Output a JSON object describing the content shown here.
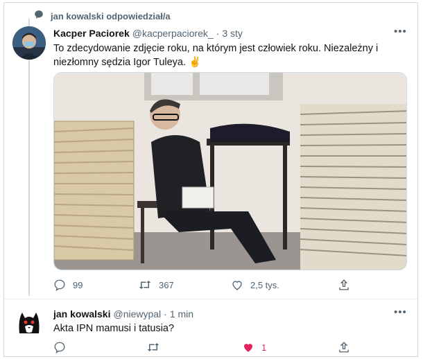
{
  "retweet": {
    "label": "jan kowalski odpowiedział/a",
    "icon": "speech-bubble-icon"
  },
  "tweet1": {
    "name": "Kacper Paciorek",
    "handle": "@kacperpaciorek_",
    "dot": "·",
    "time": "3 sty",
    "text": "To zdecydowanie zdjęcie roku, na którym jest człowiek roku. Niezależny i niezłomny sędzia Igor Tuleya. ✌️",
    "actions": {
      "replies": "99",
      "retweets": "367",
      "likes": "2,5 tys."
    }
  },
  "tweet2": {
    "name": "jan kowalski",
    "handle": "@niewypal",
    "dot": "·",
    "time": "1 min",
    "text": "Akta IPN mamusi i tatusia?",
    "actions": {
      "replies": "",
      "retweets": "",
      "likes": "1"
    }
  },
  "colors": {
    "like_active": "#e0245e",
    "muted": "#536471",
    "accent": "#1da1f2"
  }
}
